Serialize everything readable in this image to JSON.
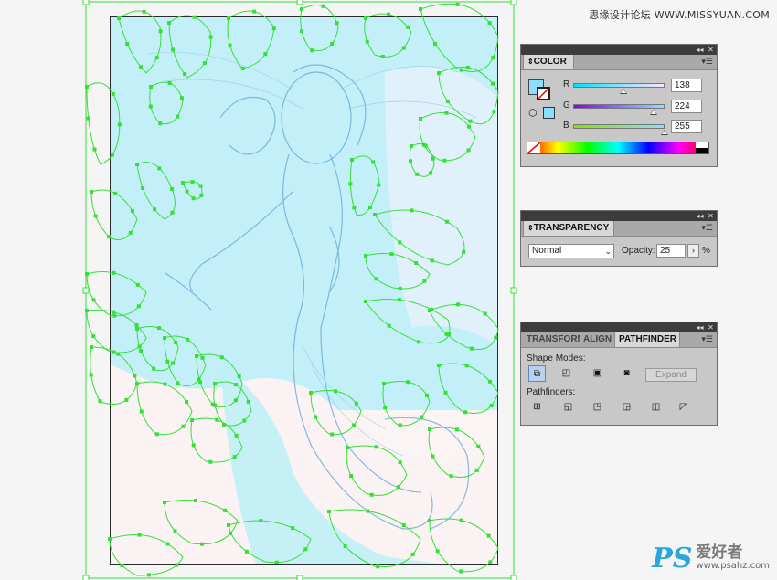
{
  "watermark": {
    "top_text": "思缘设计论坛 WWW.MISSYUAN.COM",
    "bottom_ps": "PS",
    "bottom_cn": "爱好者",
    "bottom_url": "www.psahz.com"
  },
  "color_panel": {
    "tab_label": "COLOR",
    "r_label": "R",
    "g_label": "G",
    "b_label": "B",
    "r_value": "138",
    "g_value": "224",
    "b_value": "255",
    "fill_color": "#8ae0ff",
    "r_fraction": 0.54,
    "g_fraction": 0.88,
    "b_fraction": 1.0
  },
  "transparency_panel": {
    "tab_label": "TRANSPARENCY",
    "blend_mode": "Normal",
    "opacity_label": "Opacity:",
    "opacity_value": "25",
    "opacity_unit": "%"
  },
  "pathfinder_panel": {
    "tabs": [
      "TRANSFORM",
      "ALIGN",
      "PATHFINDER"
    ],
    "shape_modes_label": "Shape Modes:",
    "expand_label": "Expand",
    "pathfinders_label": "Pathfinders:"
  },
  "colors": {
    "selection_green": "#35e035",
    "water_blue": "#a4ecf7",
    "sketch_blue": "#6aa8d8"
  }
}
